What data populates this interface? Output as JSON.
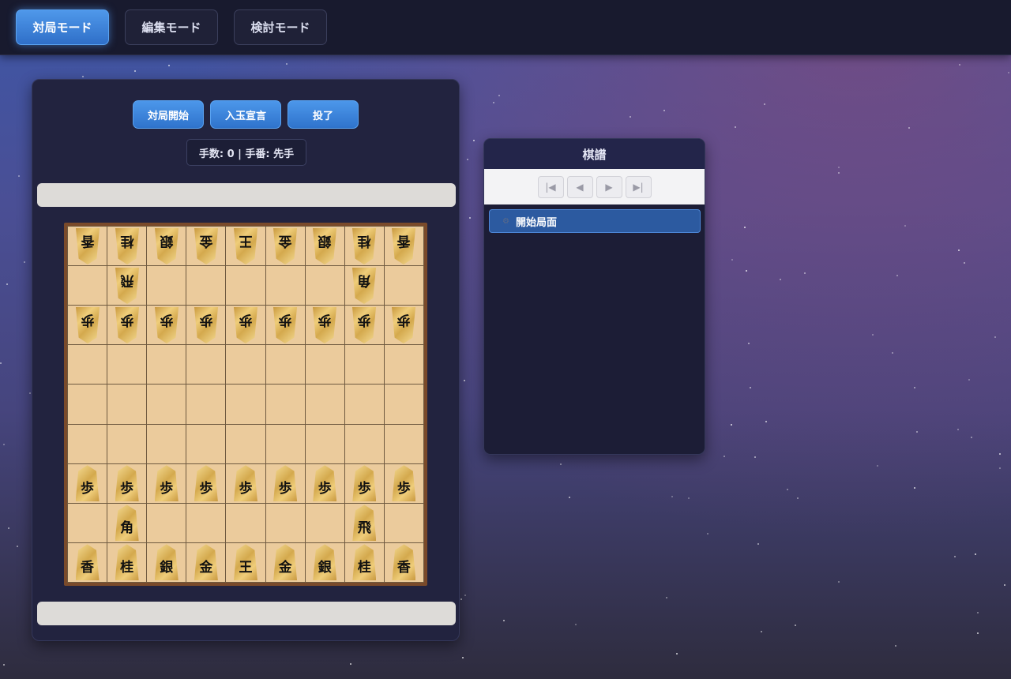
{
  "modes": [
    {
      "label": "対局モード",
      "active": true
    },
    {
      "label": "編集モード",
      "active": false
    },
    {
      "label": "検討モード",
      "active": false
    }
  ],
  "controls": {
    "start_label": "対局開始",
    "nyugyoku_label": "入玉宣言",
    "resign_label": "投了"
  },
  "status": {
    "text": "手数: 0 | 手番: 先手"
  },
  "board": {
    "rows": [
      [
        "v香",
        "v桂",
        "v銀",
        "v金",
        "v王",
        "v金",
        "v銀",
        "v桂",
        "v香"
      ],
      [
        "",
        "v飛",
        "",
        "",
        "",
        "",
        "",
        "v角",
        ""
      ],
      [
        "v歩",
        "v歩",
        "v歩",
        "v歩",
        "v歩",
        "v歩",
        "v歩",
        "v歩",
        "v歩"
      ],
      [
        "",
        "",
        "",
        "",
        "",
        "",
        "",
        "",
        ""
      ],
      [
        "",
        "",
        "",
        "",
        "",
        "",
        "",
        "",
        ""
      ],
      [
        "",
        "",
        "",
        "",
        "",
        "",
        "",
        "",
        ""
      ],
      [
        "歩",
        "歩",
        "歩",
        "歩",
        "歩",
        "歩",
        "歩",
        "歩",
        "歩"
      ],
      [
        "",
        "角",
        "",
        "",
        "",
        "",
        "",
        "飛",
        ""
      ],
      [
        "香",
        "桂",
        "銀",
        "金",
        "王",
        "金",
        "銀",
        "桂",
        "香"
      ]
    ]
  },
  "kifu": {
    "title": "棋譜",
    "nav": {
      "first": "|◀",
      "prev": "◀",
      "next": "▶",
      "last": "▶|"
    },
    "items": [
      {
        "label": "開始局面",
        "selected": true
      }
    ]
  },
  "colors": {
    "accent": "#3c84dc",
    "board": "#ebcb9c",
    "board_frame": "#7a4a2a"
  }
}
